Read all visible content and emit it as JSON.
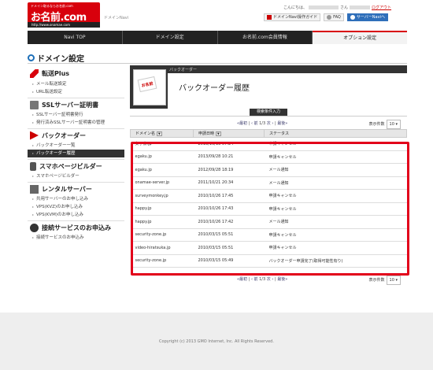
{
  "header": {
    "logo": {
      "tagline": "ドメイン取るならお名前.com",
      "name": "お名前.com",
      "url": "http://www.onamae.com"
    },
    "domain_navi": "ドメインNavi",
    "greeting_prefix": "こんにちは、",
    "greeting_suffix": "さん",
    "logout": "ログアウト",
    "buttons": {
      "guide": "ドメインNavi操作ガイド",
      "faq": "FAQ",
      "twitter": "サーバーNaviへ"
    }
  },
  "tabs": [
    "Navi TOP",
    "ドメイン設定",
    "お名前.com会員情報",
    "オプション設定"
  ],
  "page_title": "ドメイン設定",
  "sidebar": [
    {
      "title": "転送Plus",
      "icon": "arrow-icon",
      "links": [
        "メール転送設定",
        "URL転送設定"
      ]
    },
    {
      "title": "SSLサーバー証明書",
      "icon": "certificate-icon",
      "links": [
        "SSLサーバー証明書発行",
        "発行済みSSLサーバー証明書の管理"
      ]
    },
    {
      "title": "バックオーダー",
      "icon": "backorder-icon",
      "links": [
        "バックオーダー一覧",
        "バックオーダー履歴"
      ]
    },
    {
      "title": "スマホページビルダー",
      "icon": "smartphone-icon",
      "links": [
        "スマホページビルダー"
      ]
    },
    {
      "title": "レンタルサーバー",
      "icon": "server-icon",
      "links": [
        "共用サーバーのお申し込み",
        "VPS(KVZ)のお申し込み",
        "VPS(KVM)のお申し込み"
      ]
    },
    {
      "title": "接続サービスのお申込み",
      "icon": "connection-icon",
      "links": [
        "接続サービスのお申込み"
      ]
    }
  ],
  "main": {
    "section_label": "バックオーダー",
    "title": "バックオーダー履歴",
    "thumb_text": "お名前",
    "search_button": "検索条件入力",
    "pager": {
      "first": "«最初",
      "prev": "‹ 前",
      "page": "1/3",
      "next": "次 ›",
      "last": "最後»",
      "count_label": "表示件数",
      "count_value": "10"
    },
    "columns": [
      "ドメイン名",
      "申請日時",
      "ステータス"
    ],
    "rows": [
      [
        "女子会.jp",
        "2013/10/13 07:24",
        "申請キャンセル"
      ],
      [
        "egaku.jp",
        "2013/09/28 10:21",
        "申請キャンセル"
      ],
      [
        "egaku.jp",
        "2012/09/28 18:19",
        "メール通知"
      ],
      [
        "onamae-server.jp",
        "2011/10/21 20:34",
        "メール通知"
      ],
      [
        "surveymonkey.jp",
        "2010/10/26 17:45",
        "申請キャンセル"
      ],
      [
        "happy.jp",
        "2010/10/26 17:43",
        "申請キャンセル"
      ],
      [
        "happy.jp",
        "2010/10/26 17:42",
        "メール通知"
      ],
      [
        "security-zone.jp",
        "2010/03/15 05:51",
        "申請キャンセル"
      ],
      [
        "video-hiratsuka.jp",
        "2010/03/15 05:51",
        "申請キャンセル"
      ],
      [
        "security-zone.jp",
        "2010/03/15 05:49",
        "バックオーダー申請完了(取得可能性有り)"
      ]
    ]
  },
  "footer": {
    "copyright": "Copyright (c) 2013 GMO Internet, Inc. All Rights Reserved."
  },
  "colors": {
    "brand_red": "#d8000c",
    "highlight_border": "#e2001a",
    "tab_bar": "#222222"
  }
}
